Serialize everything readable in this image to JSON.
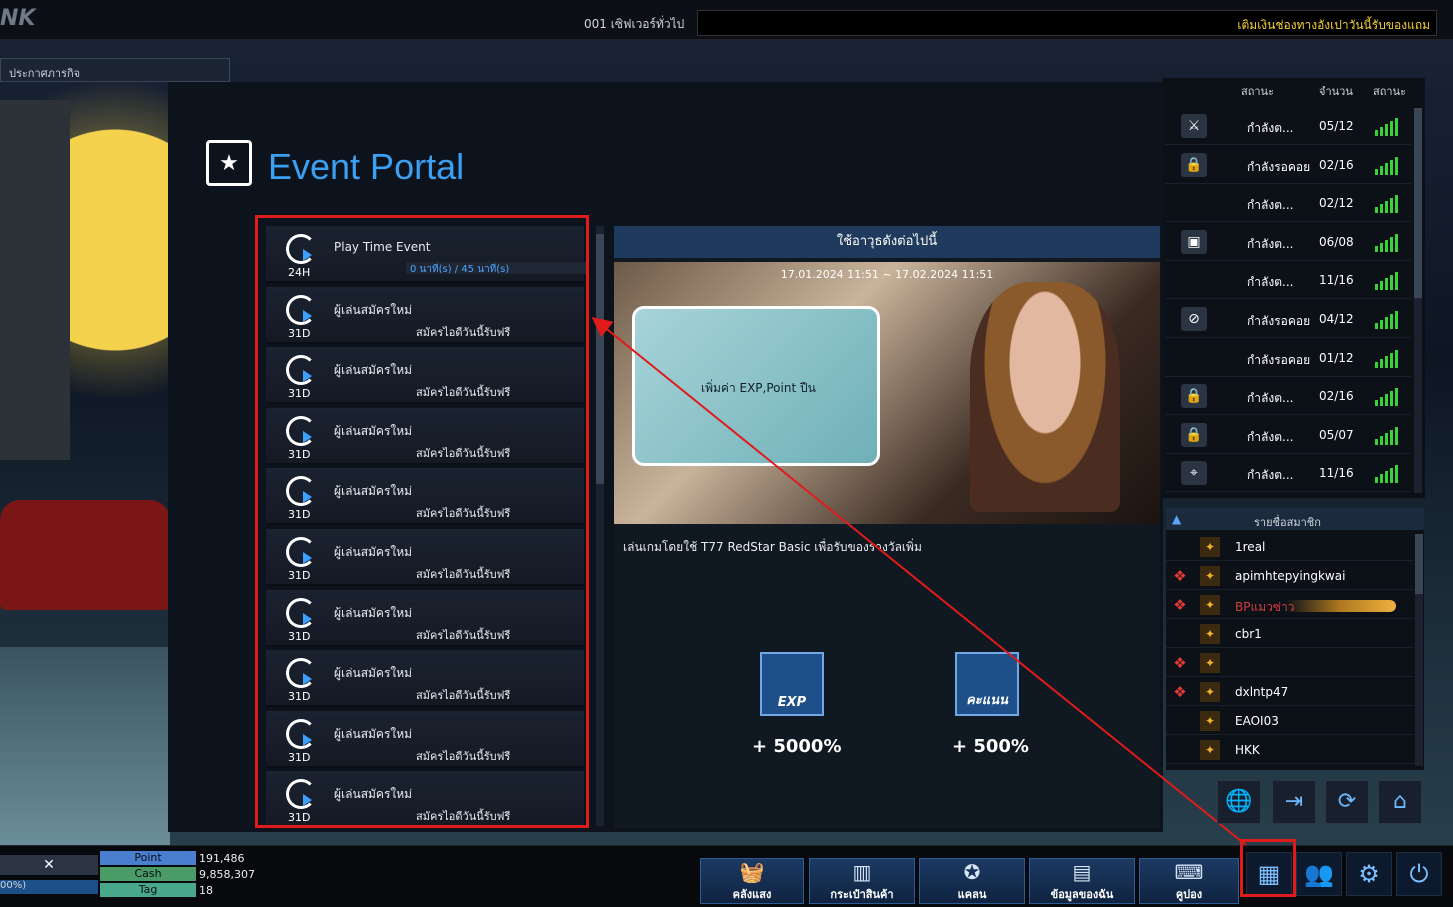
{
  "top": {
    "logo": "NK",
    "server": "001 เซิฟเวอร์ทั่วไป",
    "marquee": "เติมเงินช่องทางอังเปาวันนี้รับของแถม"
  },
  "notice_tab": "ประกาศภารกิจ",
  "portal": {
    "title": "Event Portal"
  },
  "events": [
    {
      "name": "Play Time Event",
      "days": "24H",
      "progress": "0 นาที(s) / 45 นาที(s)",
      "progress_fraction": 0
    },
    {
      "name": "ผู้เล่นสมัครใหม่",
      "days": "31D",
      "sub": "สมัครไอดีวันนี้รับฟรี"
    },
    {
      "name": "ผู้เล่นสมัครใหม่",
      "days": "31D",
      "sub": "สมัครไอดีวันนี้รับฟรี"
    },
    {
      "name": "ผู้เล่นสมัครใหม่",
      "days": "31D",
      "sub": "สมัครไอดีวันนี้รับฟรี"
    },
    {
      "name": "ผู้เล่นสมัครใหม่",
      "days": "31D",
      "sub": "สมัครไอดีวันนี้รับฟรี"
    },
    {
      "name": "ผู้เล่นสมัครใหม่",
      "days": "31D",
      "sub": "สมัครไอดีวันนี้รับฟรี"
    },
    {
      "name": "ผู้เล่นสมัครใหม่",
      "days": "31D",
      "sub": "สมัครไอดีวันนี้รับฟรี"
    },
    {
      "name": "ผู้เล่นสมัครใหม่",
      "days": "31D",
      "sub": "สมัครไอดีวันนี้รับฟรี"
    },
    {
      "name": "ผู้เล่นสมัครใหม่",
      "days": "31D",
      "sub": "สมัครไอดีวันนี้รับฟรี"
    },
    {
      "name": "ผู้เล่นสมัครใหม่",
      "days": "31D",
      "sub": "สมัครไอดีวันนี้รับฟรี"
    }
  ],
  "detail": {
    "header": "ใช้อาวุธดังต่อไปนี้",
    "date": "17.01.2024 11:51 ~ 17.02.2024 11:51",
    "bubble": "เพิ่มค่า EXP,Point ปืน",
    "desc": "เล่นเกมโดยใช้ T77 RedStar Basic เพื่อรับของรางวัลเพิ่ม",
    "rewards": [
      {
        "icon": "EXP",
        "value": "+ 5000%"
      },
      {
        "icon": "คะแนน",
        "value": "+ 500%"
      }
    ]
  },
  "rooms": {
    "headers": [
      "สถานะ",
      "จำนวน",
      "สถานะ"
    ],
    "rows": [
      {
        "icon": "knife-icon",
        "glyph": "⚔",
        "state": "กำลังต...",
        "count": "05/12"
      },
      {
        "icon": "lock-icon",
        "glyph": "🔒",
        "state": "กำลังรอคอย",
        "count": "02/16"
      },
      {
        "icon": "",
        "glyph": "",
        "state": "กำลังต...",
        "count": "02/12"
      },
      {
        "icon": "box-icon",
        "glyph": "▣",
        "state": "กำลังต...",
        "count": "06/08"
      },
      {
        "icon": "",
        "glyph": "",
        "state": "กำลังต...",
        "count": "11/16"
      },
      {
        "icon": "no-icon",
        "glyph": "⊘",
        "state": "กำลังรอคอย",
        "count": "04/12"
      },
      {
        "icon": "",
        "glyph": "",
        "state": "กำลังรอคอย",
        "count": "01/12"
      },
      {
        "icon": "lock-icon",
        "glyph": "🔒",
        "state": "กำลังต...",
        "count": "02/16"
      },
      {
        "icon": "lock-icon",
        "glyph": "🔒",
        "state": "กำลังต...",
        "count": "05/07"
      },
      {
        "icon": "target-icon",
        "glyph": "⌖",
        "state": "กำลังต...",
        "count": "11/16"
      }
    ]
  },
  "members": {
    "title": "รายชื่อสมาชิก",
    "rows": [
      {
        "name": "1real",
        "clan": false,
        "red": false
      },
      {
        "name": "apimhtepyingkwai",
        "clan": true,
        "red": false
      },
      {
        "name": "BPแมวซ่าว",
        "clan": true,
        "red": true,
        "bullet": true
      },
      {
        "name": "cbr1",
        "clan": false,
        "red": false
      },
      {
        "name": "",
        "clan": true,
        "red": false
      },
      {
        "name": "dxlntp47",
        "clan": true,
        "red": false
      },
      {
        "name": "EAOI03",
        "clan": false,
        "red": false
      },
      {
        "name": "HKK",
        "clan": false,
        "red": false
      }
    ]
  },
  "stats": {
    "icon": "✕",
    "bar": "00%)",
    "point_label": "Point",
    "point_value": "191,486",
    "cash_label": "Cash",
    "cash_value": "9,858,307",
    "tag_label": "Tag",
    "tag_value": "18"
  },
  "menu": [
    {
      "label": "คลังแสง",
      "glyph": "🧺"
    },
    {
      "label": "กระเป๋าสินค้า",
      "glyph": "▥"
    },
    {
      "label": "แคลน",
      "glyph": "✪"
    },
    {
      "label": "ข้อมูลของฉัน",
      "glyph": "▤"
    },
    {
      "label": "คูปอง",
      "glyph": "⌨"
    }
  ],
  "tools": [
    "🌐",
    "⇥",
    "⟳",
    "⌂"
  ],
  "sys": [
    "▦",
    "👥",
    "⚙",
    "⏻"
  ]
}
